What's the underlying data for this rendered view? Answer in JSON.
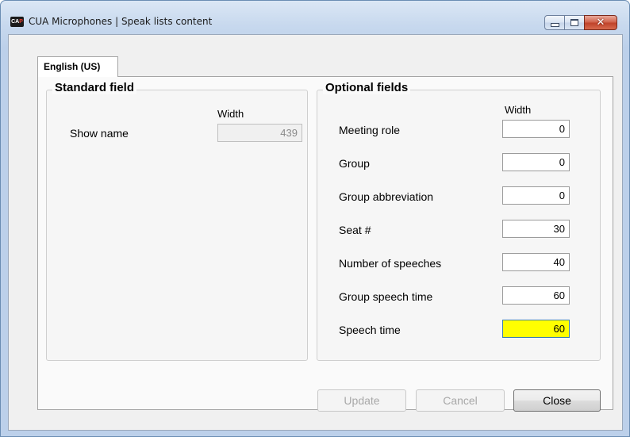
{
  "window": {
    "title": "CUA Microphones | Speak lists content",
    "icon_text_left": "CA",
    "icon_text_accent": "P"
  },
  "tabs": [
    {
      "label": "English (US)",
      "selected": true
    }
  ],
  "standard": {
    "title": "Standard field",
    "width_header": "Width",
    "fields": [
      {
        "label": "Show name",
        "value": "439",
        "enabled": false
      }
    ]
  },
  "optional": {
    "title": "Optional fields",
    "width_header": "Width",
    "fields": [
      {
        "label": "Meeting role",
        "value": "0"
      },
      {
        "label": "Group",
        "value": "0"
      },
      {
        "label": "Group abbreviation",
        "value": "0"
      },
      {
        "label": "Seat #",
        "value": "30"
      },
      {
        "label": "Number of speeches",
        "value": "40"
      },
      {
        "label": "Group speech time",
        "value": "60"
      },
      {
        "label": "Speech time",
        "value": "60",
        "focused": true
      }
    ]
  },
  "buttons": {
    "update": {
      "label": "Update",
      "enabled": false
    },
    "cancel": {
      "label": "Cancel",
      "enabled": false
    },
    "close": {
      "label": "Close",
      "enabled": true
    }
  },
  "colors": {
    "focused_field_bg": "#ffff00",
    "close_button": "#c0432a"
  }
}
